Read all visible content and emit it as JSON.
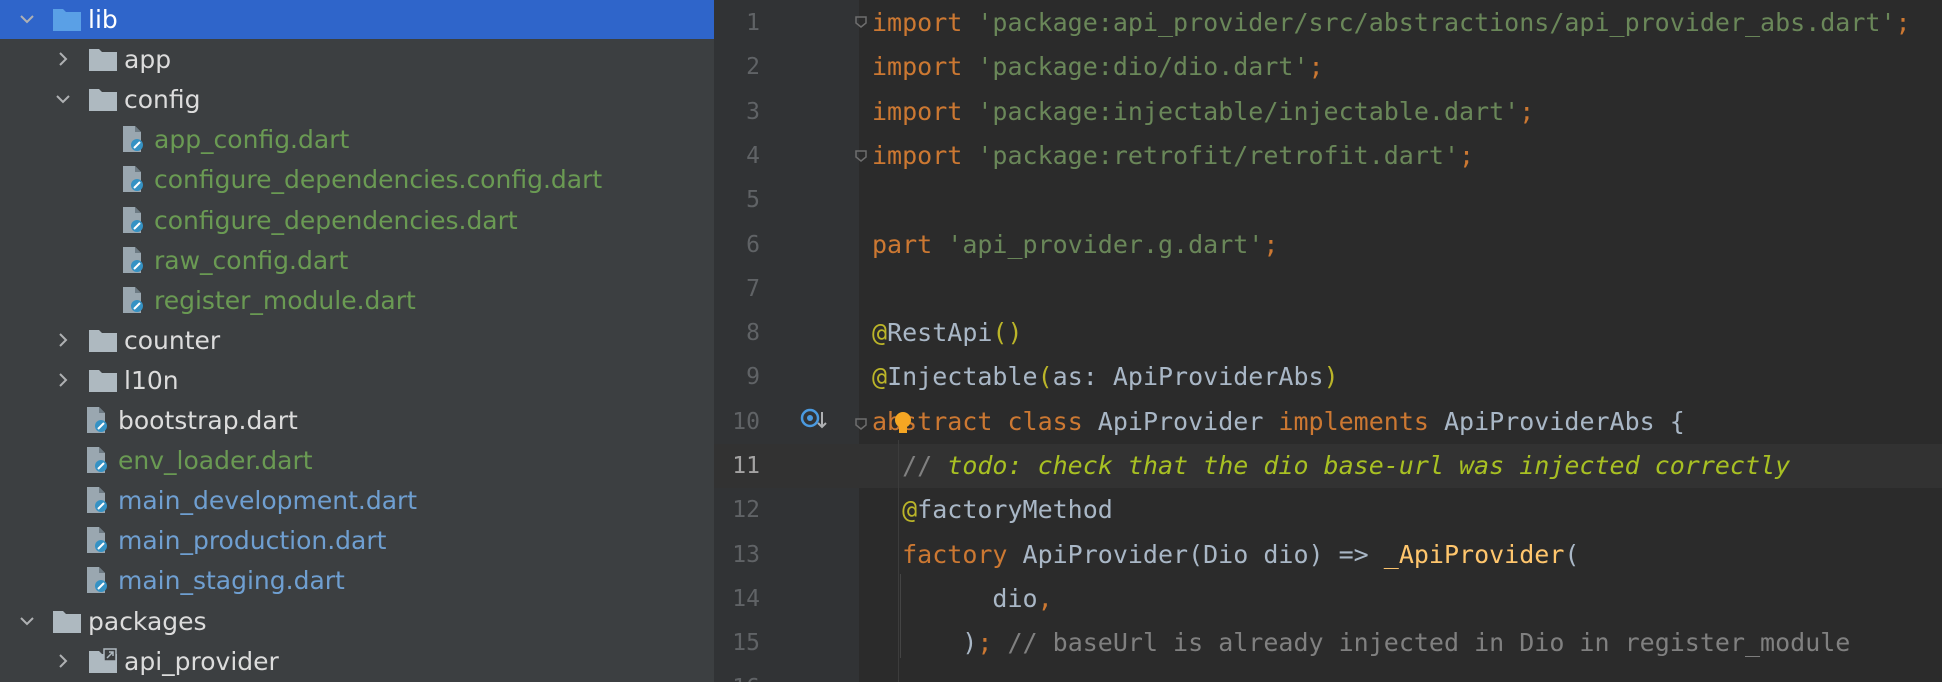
{
  "project_tree": {
    "items": [
      {
        "label": "lib",
        "kind": "folder",
        "state": "expanded",
        "color": "default",
        "selected": true
      },
      {
        "label": "app",
        "kind": "folder",
        "state": "collapsed",
        "color": "default",
        "selected": false
      },
      {
        "label": "config",
        "kind": "folder",
        "state": "expanded",
        "color": "default",
        "selected": false
      },
      {
        "label": "app_config.dart",
        "kind": "file",
        "state": "none",
        "color": "green",
        "selected": false
      },
      {
        "label": "configure_dependencies.config.dart",
        "kind": "file",
        "state": "none",
        "color": "green",
        "selected": false
      },
      {
        "label": "configure_dependencies.dart",
        "kind": "file",
        "state": "none",
        "color": "green",
        "selected": false
      },
      {
        "label": "raw_config.dart",
        "kind": "file",
        "state": "none",
        "color": "green",
        "selected": false
      },
      {
        "label": "register_module.dart",
        "kind": "file",
        "state": "none",
        "color": "green",
        "selected": false
      },
      {
        "label": "counter",
        "kind": "folder",
        "state": "collapsed",
        "color": "default",
        "selected": false
      },
      {
        "label": "l10n",
        "kind": "folder",
        "state": "collapsed",
        "color": "default",
        "selected": false
      },
      {
        "label": "bootstrap.dart",
        "kind": "file",
        "state": "none",
        "color": "default",
        "selected": false
      },
      {
        "label": "env_loader.dart",
        "kind": "file",
        "state": "none",
        "color": "green",
        "selected": false
      },
      {
        "label": "main_development.dart",
        "kind": "file",
        "state": "none",
        "color": "blue",
        "selected": false
      },
      {
        "label": "main_production.dart",
        "kind": "file",
        "state": "none",
        "color": "blue",
        "selected": false
      },
      {
        "label": "main_staging.dart",
        "kind": "file",
        "state": "none",
        "color": "blue",
        "selected": false
      },
      {
        "label": "packages",
        "kind": "folder",
        "state": "expanded",
        "color": "default",
        "selected": false
      },
      {
        "label": "api_provider",
        "kind": "module-folder",
        "state": "collapsed",
        "color": "default",
        "selected": false
      }
    ]
  },
  "editor": {
    "current_line": "11",
    "lines": [
      {
        "num": "1",
        "tokens": [
          {
            "t": "import",
            "c": "kw"
          },
          {
            "t": " "
          },
          {
            "t": "'package:api_provider/src/abstractions/api_provider_abs.dart'",
            "c": "str"
          },
          {
            "t": ";",
            "c": "kw"
          }
        ]
      },
      {
        "num": "2",
        "tokens": [
          {
            "t": "import",
            "c": "kw"
          },
          {
            "t": " "
          },
          {
            "t": "'package:dio/dio.dart'",
            "c": "str"
          },
          {
            "t": ";",
            "c": "kw"
          }
        ]
      },
      {
        "num": "3",
        "tokens": [
          {
            "t": "import",
            "c": "kw"
          },
          {
            "t": " "
          },
          {
            "t": "'package:injectable/injectable.dart'",
            "c": "str"
          },
          {
            "t": ";",
            "c": "kw"
          }
        ]
      },
      {
        "num": "4",
        "tokens": [
          {
            "t": "import",
            "c": "kw"
          },
          {
            "t": " "
          },
          {
            "t": "'package:retrofit/retrofit.dart'",
            "c": "str"
          },
          {
            "t": ";",
            "c": "kw"
          }
        ]
      },
      {
        "num": "5",
        "tokens": []
      },
      {
        "num": "6",
        "tokens": [
          {
            "t": "part",
            "c": "kw"
          },
          {
            "t": " "
          },
          {
            "t": "'api_provider.g.dart'",
            "c": "str"
          },
          {
            "t": ";",
            "c": "kw"
          }
        ]
      },
      {
        "num": "7",
        "tokens": []
      },
      {
        "num": "8",
        "tokens": [
          {
            "t": "@",
            "c": "ann"
          },
          {
            "t": "RestApi"
          },
          {
            "t": "()",
            "c": "ann"
          }
        ]
      },
      {
        "num": "9",
        "tokens": [
          {
            "t": "@",
            "c": "ann"
          },
          {
            "t": "Injectable"
          },
          {
            "t": "(",
            "c": "ann"
          },
          {
            "t": "as: ApiProviderAbs"
          },
          {
            "t": ")",
            "c": "ann"
          }
        ]
      },
      {
        "num": "10",
        "tokens": [
          {
            "t": "abstract",
            "c": "kw"
          },
          {
            "t": " "
          },
          {
            "t": "class",
            "c": "kw"
          },
          {
            "t": " ApiProvider "
          },
          {
            "t": "implements",
            "c": "kw"
          },
          {
            "t": " ApiProviderAbs {"
          }
        ]
      },
      {
        "num": "11",
        "tokens": [
          {
            "t": "  "
          },
          {
            "t": "// ",
            "c": "cmt"
          },
          {
            "t": "todo: check that the dio base-url was injected correctly",
            "c": "todo"
          }
        ]
      },
      {
        "num": "12",
        "tokens": [
          {
            "t": "  "
          },
          {
            "t": "@",
            "c": "ann"
          },
          {
            "t": "factoryMethod"
          }
        ]
      },
      {
        "num": "13",
        "tokens": [
          {
            "t": "  "
          },
          {
            "t": "factory",
            "c": "kw"
          },
          {
            "t": " ApiProvider(Dio dio) => "
          },
          {
            "t": "_ApiProvider",
            "c": "fn"
          },
          {
            "t": "("
          }
        ]
      },
      {
        "num": "14",
        "tokens": [
          {
            "t": "        dio"
          },
          {
            "t": ",",
            "c": "kw"
          }
        ]
      },
      {
        "num": "15",
        "tokens": [
          {
            "t": "      )"
          },
          {
            "t": ";",
            "c": "kw"
          },
          {
            "t": " "
          },
          {
            "t": "// baseUrl is already injected in Dio in register_module",
            "c": "cmt"
          }
        ]
      },
      {
        "num": "16",
        "tokens": []
      }
    ]
  },
  "colors": {
    "sidebar_bg": "#3c3f41",
    "selection": "#2f65ca",
    "editor_bg": "#2b2b2b",
    "keyword": "#cc7832",
    "string": "#6a8759",
    "annotation": "#bbb529",
    "comment": "#808080",
    "todo": "#a8c023",
    "function": "#ffc66d"
  }
}
